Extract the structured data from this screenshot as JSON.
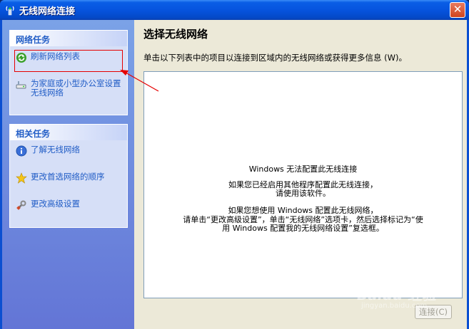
{
  "window": {
    "title": "无线网络连接",
    "close_label": "✕"
  },
  "network_tasks": {
    "header": "网络任务",
    "items": [
      {
        "label": "刷新网络列表",
        "icon": "refresh-icon"
      },
      {
        "label": "为家庭或小型办公室设置无线网络",
        "icon": "network-setup-icon"
      }
    ]
  },
  "related_tasks": {
    "header": "相关任务",
    "items": [
      {
        "label": "了解无线网络",
        "icon": "info-icon"
      },
      {
        "label": "更改首选网络的顺序",
        "icon": "star-icon"
      },
      {
        "label": "更改高级设置",
        "icon": "settings-icon"
      }
    ]
  },
  "main": {
    "title": "选择无线网络",
    "description": "单击以下列表中的项目以连接到区域内的无线网络或获得更多信息 (W)。",
    "message": {
      "line1": "Windows 无法配置此无线连接",
      "line2": "如果您已经启用其他程序配置此无线连接，",
      "line3": "请使用该软件。",
      "line4": "如果您想使用 Windows 配置此无线网络，",
      "line5": "请单击“更改高级设置”，单击“无线网络”选项卡，然后选择标记为“使",
      "line6": "用 Windows 配置我的无线网络设置”复选框。"
    },
    "connect_label": "连接(C)"
  },
  "watermark": {
    "text": "Baidu 经验",
    "sub": "jingyan.baidu.com"
  },
  "colors": {
    "titlebar": "#0654de",
    "task_link": "#215dc6",
    "annotation": "#e60000"
  }
}
